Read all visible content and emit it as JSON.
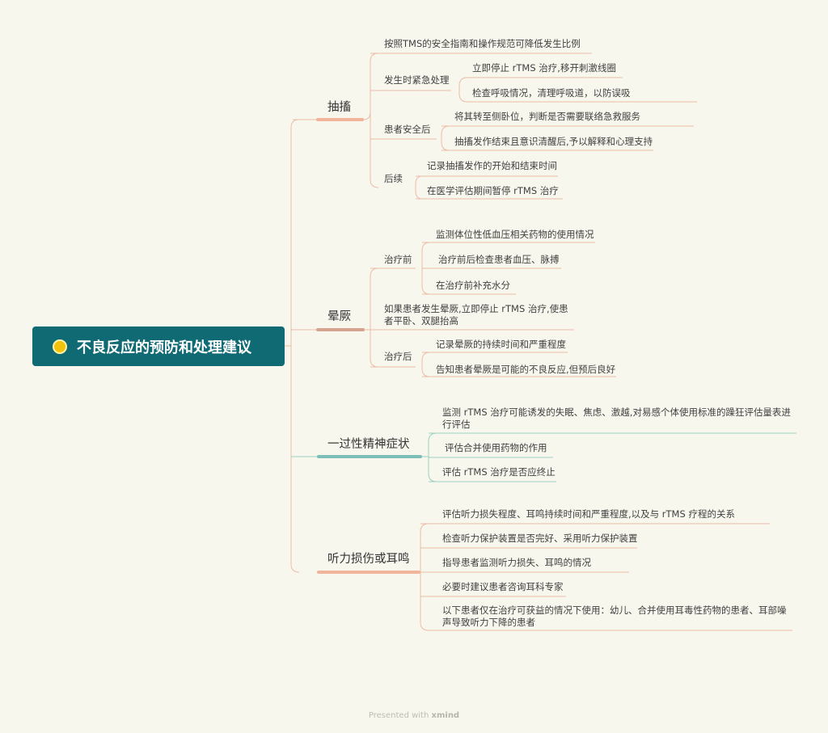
{
  "root": {
    "title": "不良反应的预防和处理建议"
  },
  "branches": [
    {
      "label": "抽搐",
      "children": [
        {
          "label": "按照TMS的安全指南和操作规范可降低发生比例"
        },
        {
          "label": "发生时紧急处理",
          "children": [
            {
              "label": "立即停止 rTMS 治疗,移开刺激线圈"
            },
            {
              "label": "检查呼吸情况，清理呼吸道，以防误吸"
            }
          ]
        },
        {
          "label": "患者安全后",
          "children": [
            {
              "label": "将其转至侧卧位，判断是否需要联络急救服务"
            },
            {
              "label": "抽搐发作结束且意识清醒后,予以解释和心理支持"
            }
          ]
        },
        {
          "label": "后续",
          "children": [
            {
              "label": "记录抽搐发作的开始和结束时间"
            },
            {
              "label": "在医学评估期间暂停 rTMS 治疗"
            }
          ]
        }
      ]
    },
    {
      "label": "晕厥",
      "children": [
        {
          "label": "治疗前",
          "children": [
            {
              "label": "监测体位性低血压相关药物的使用情况"
            },
            {
              "label": "治疗前后检查患者血压、脉搏"
            },
            {
              "label": "在治疗前补充水分"
            }
          ]
        },
        {
          "label": "如果患者发生晕厥,立即停止 rTMS 治疗,使患者平卧、双腿抬高"
        },
        {
          "label": "治疗后",
          "children": [
            {
              "label": "记录晕厥的持续时间和严重程度"
            },
            {
              "label": "告知患者晕厥是可能的不良反应,但预后良好"
            }
          ]
        }
      ]
    },
    {
      "label": "一过性精神症状",
      "children": [
        {
          "label": "监测 rTMS 治疗可能诱发的失眠、焦虑、激越,对易感个体使用标准的躁狂评估量表进行评估"
        },
        {
          "label": "评估合并使用药物的作用"
        },
        {
          "label": "评估 rTMS 治疗是否应终止"
        }
      ]
    },
    {
      "label": "听力损伤或耳鸣",
      "children": [
        {
          "label": "评估听力损失程度、耳鸣持续时间和严重程度,以及与 rTMS 疗程的关系"
        },
        {
          "label": "检查听力保护装置是否完好、采用听力保护装置"
        },
        {
          "label": "指导患者监测听力损失、耳鸣的情况"
        },
        {
          "label": "必要时建议患者咨询耳科专家"
        },
        {
          "label": "以下患者仅在治疗可获益的情况下使用：幼儿、合并使用耳毒性药物的患者、耳部噪声导致听力下降的患者"
        }
      ]
    }
  ],
  "colors": {
    "orange": "#e9a98c",
    "teal": "#7cc1ad",
    "root": "#0f6a73"
  },
  "footer": {
    "prefix": "Presented with",
    "brand": "xmind"
  }
}
